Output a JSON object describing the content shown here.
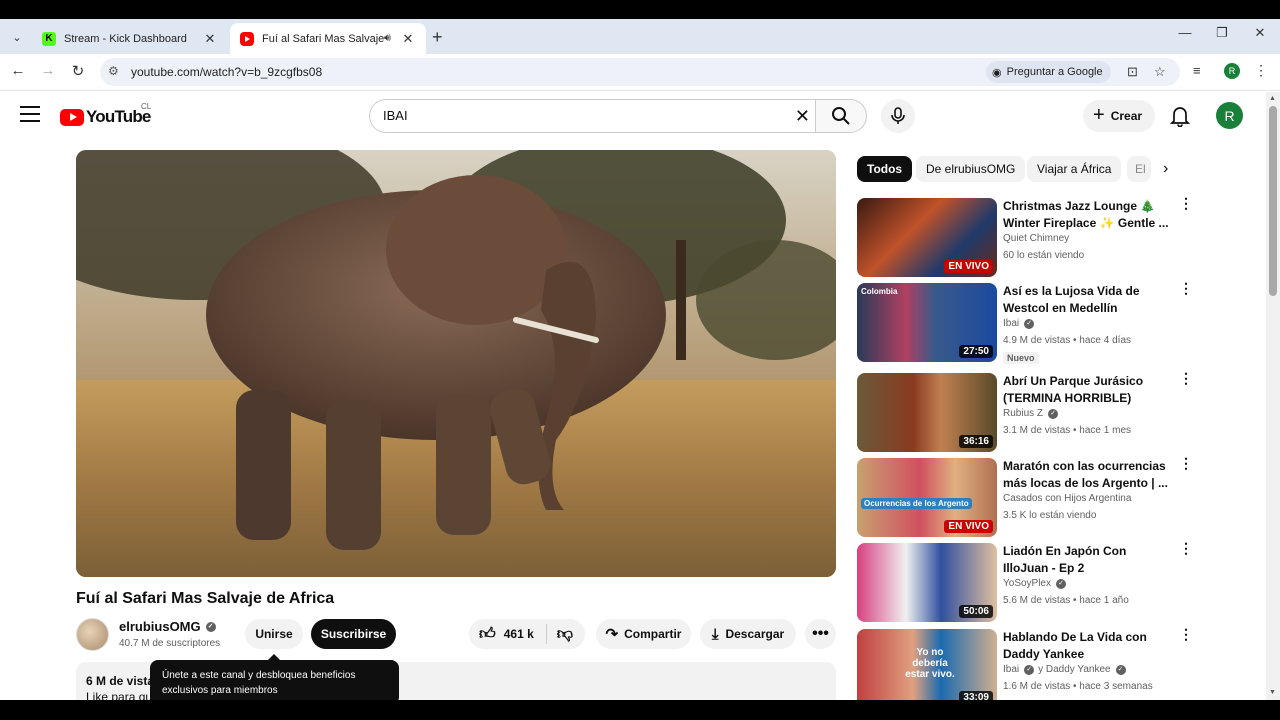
{
  "browser": {
    "tabs": [
      {
        "title": "Stream - Kick Dashboard",
        "favicon": "kick-icon",
        "active": false
      },
      {
        "title": "Fuí al Safari Mas Salvaje de",
        "favicon": "youtube-icon",
        "active": true
      }
    ],
    "url": "youtube.com/watch?v=b_9zcgfbs08",
    "ask_google": "Preguntar a Google",
    "profile_initial": "R"
  },
  "youtube": {
    "country_code": "CL",
    "logo_text": "YouTube",
    "search_value": "IBAI",
    "search_placeholder": "Buscar",
    "create_label": "Crear",
    "avatar_initial": "R"
  },
  "video": {
    "title": "Fuí al Safari Mas Salvaje de Africa",
    "channel": "elrubiusOMG",
    "subscribers": "40.7 M de suscriptores",
    "join_label": "Unirse",
    "subscribe_label": "Suscribirse",
    "likes": "461 k",
    "share_label": "Compartir",
    "download_label": "Descargar",
    "description_views": "6 M de vista",
    "description_snippet": "Like para qu",
    "tooltip": "Únete a este canal y desbloquea beneficios exclusivos para miembros"
  },
  "chips": [
    "Todos",
    "De elrubiusOMG",
    "Viajar a África",
    "El"
  ],
  "recommendations": [
    {
      "title": "Christmas Jazz Lounge 🎄 Winter Fireplace ✨ Gentle ...",
      "channel": "Quiet Chimney",
      "verified": false,
      "meta": "60 lo están viendo",
      "overlay": "EN VIVO",
      "live": true,
      "badge": ""
    },
    {
      "title": "Así es la Lujosa Vida de Westcol en Medellín",
      "channel": "Ibai",
      "verified": true,
      "meta": "4.9 M de vistas • hace 4 días",
      "overlay": "27:50",
      "live": false,
      "badge": "Nuevo",
      "thumb_label": "Colombia"
    },
    {
      "title": "Abrí Un Parque Jurásico (TERMINA HORRIBLE)",
      "channel": "Rubius Z",
      "verified": true,
      "meta": "3.1 M de vistas • hace 1 mes",
      "overlay": "36:16",
      "live": false,
      "badge": ""
    },
    {
      "title": "Maratón con las ocurrencias más locas de los Argento | ...",
      "channel": "Casados con Hijos Argentina",
      "verified": false,
      "meta": "3.5 K lo están viendo",
      "overlay": "EN VIVO",
      "live": true,
      "badge": "",
      "thumb_label": "Ocurrencias de los Argento"
    },
    {
      "title": "Liadón En Japón Con IlloJuan - Ep 2",
      "channel": "YoSoyPlex",
      "verified": true,
      "meta": "5.6 M de vistas • hace 1 año",
      "overlay": "50:06",
      "live": false,
      "badge": ""
    },
    {
      "title": "Hablando De La Vida con Daddy Yankee",
      "channel": "Ibai",
      "channel2": "y Daddy Yankee",
      "verified": true,
      "meta": "1.6 M de vistas • hace 3 semanas",
      "overlay": "33:09",
      "live": false,
      "badge": "",
      "thumb_label": "Yo no debería estar vivo."
    }
  ]
}
